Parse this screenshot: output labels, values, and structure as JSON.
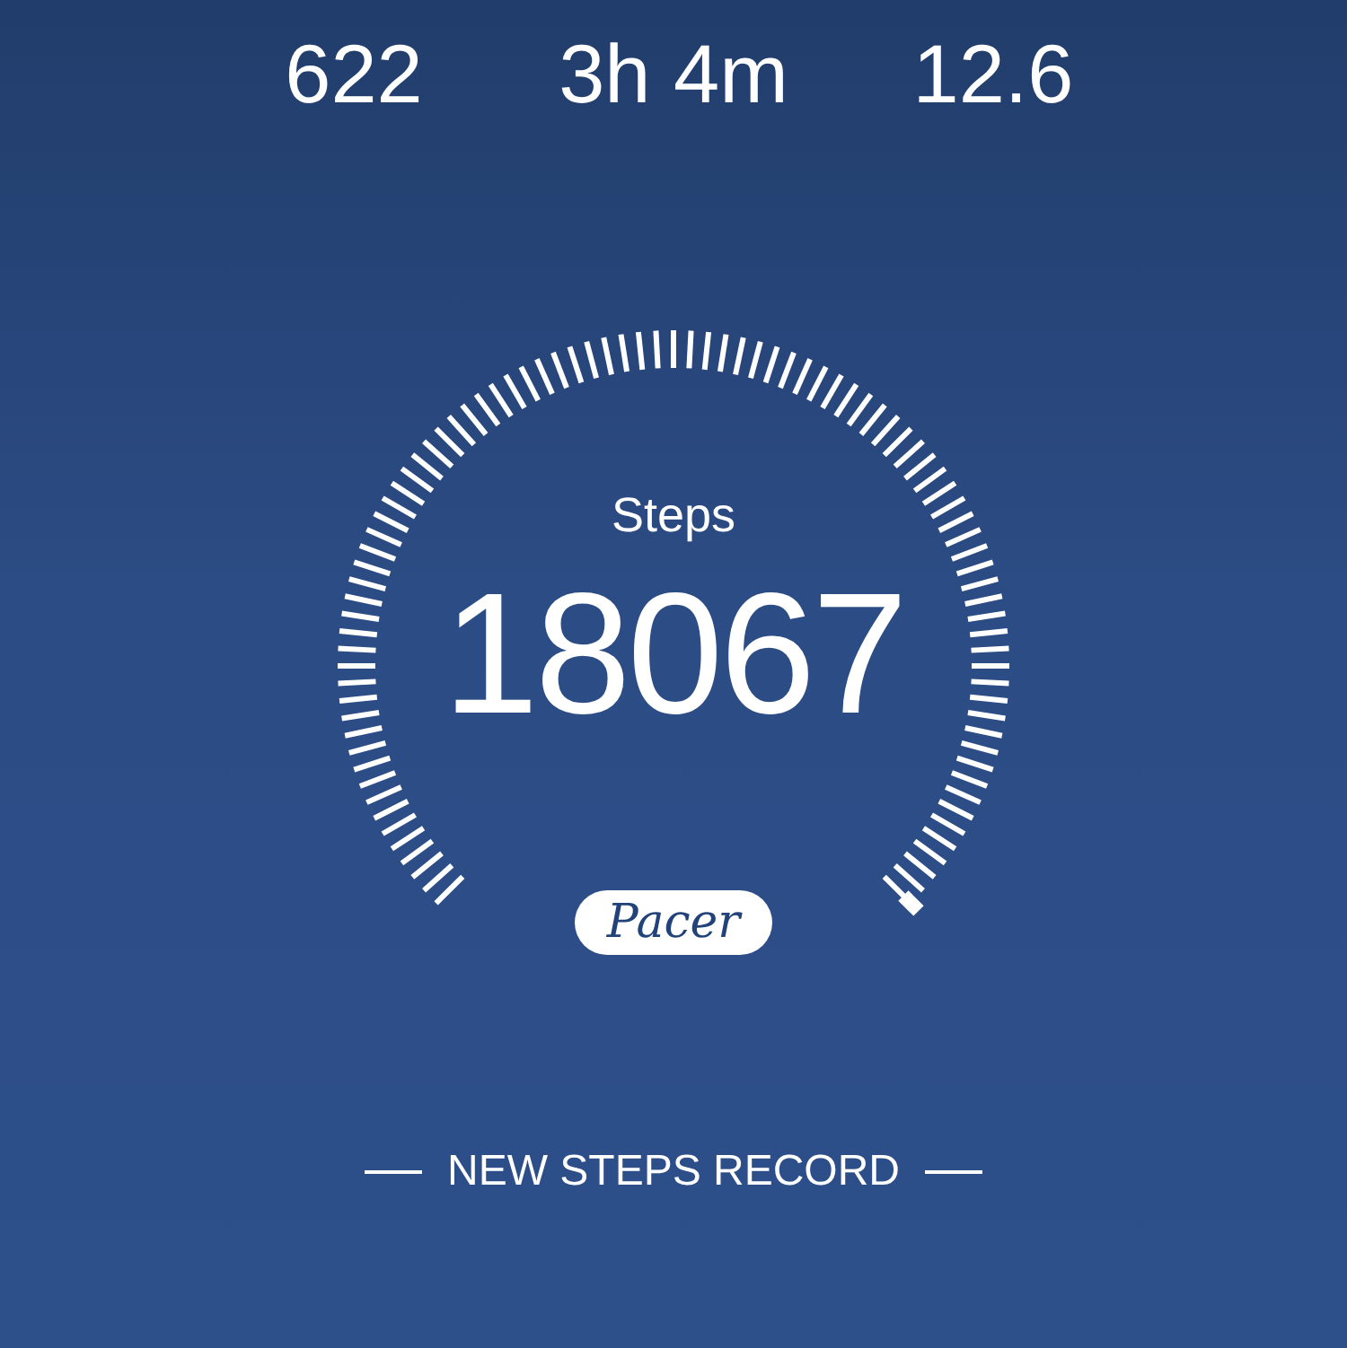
{
  "stats": [
    {
      "value": "622"
    },
    {
      "value": "3h 4m"
    },
    {
      "value": "12.6"
    }
  ],
  "gauge": {
    "label": "Steps",
    "value": "18067"
  },
  "logo": "Pacer",
  "record": "NEW STEPS RECORD"
}
